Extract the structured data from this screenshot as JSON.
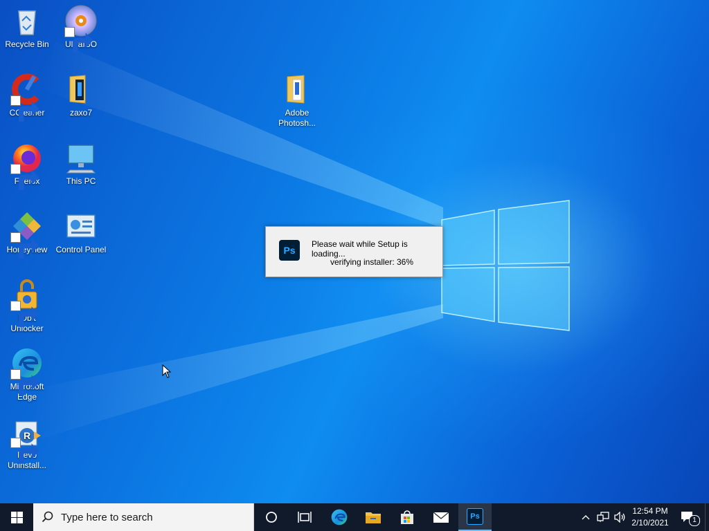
{
  "desktop": {
    "icons": [
      {
        "label": "Recycle Bin"
      },
      {
        "label": "UltraISO"
      },
      {
        "label": "CCleaner"
      },
      {
        "label": "zaxo7"
      },
      {
        "label": "Firefox"
      },
      {
        "label": "This PC"
      },
      {
        "label": "Honeyview"
      },
      {
        "label": "Control Panel"
      },
      {
        "label": "IObit Unlocker"
      },
      {
        "label": "Microsoft Edge"
      },
      {
        "label": "Revo Uninstall..."
      },
      {
        "label": "Adobe Photosh..."
      }
    ]
  },
  "setup_dialog": {
    "logo_text": "Ps",
    "message": "Please wait while Setup is loading...",
    "status": "verifying installer: 36%",
    "progress_percent": 36
  },
  "taskbar": {
    "search_placeholder": "Type here to search",
    "pinned": [
      "cortana-icon",
      "task-view-icon",
      "edge-icon",
      "file-explorer-icon",
      "store-icon",
      "mail-icon",
      "photoshop-icon"
    ],
    "photoshop_label": "Ps",
    "time": "12:54 PM",
    "date": "2/10/2021",
    "notification_count": "1"
  },
  "colors": {
    "taskbar": "#101a2a",
    "accent": "#0a74e0",
    "photoshop_bg": "#001e36",
    "photoshop_fg": "#31a8ff"
  }
}
